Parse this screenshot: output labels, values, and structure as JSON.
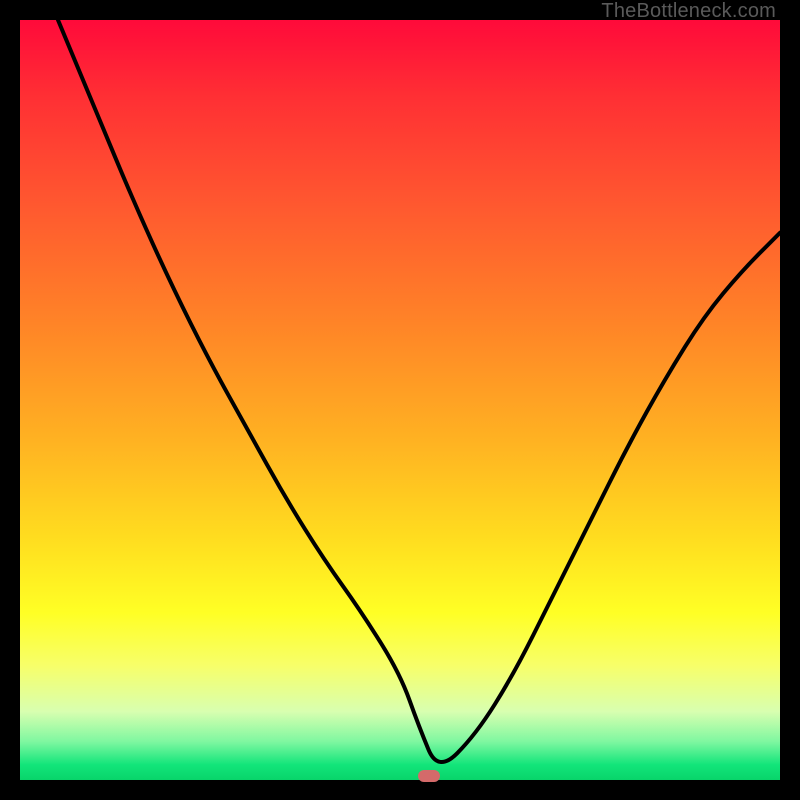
{
  "watermark": "TheBottleneck.com",
  "chart_data": {
    "type": "line",
    "title": "",
    "xlabel": "",
    "ylabel": "",
    "xlim": [
      0,
      100
    ],
    "ylim": [
      0,
      100
    ],
    "grid": false,
    "legend": false,
    "series": [
      {
        "name": "bottleneck-curve",
        "x": [
          5,
          10,
          15,
          20,
          25,
          30,
          35,
          40,
          45,
          50,
          52.5,
          55,
          60,
          65,
          70,
          75,
          80,
          85,
          90,
          95,
          100
        ],
        "y": [
          100,
          88,
          76,
          65,
          55,
          46,
          37,
          29,
          22,
          14,
          7,
          1,
          6,
          14,
          24,
          34,
          44,
          53,
          61,
          67,
          72
        ]
      }
    ],
    "marker": {
      "x": 53.8,
      "y": 0.5,
      "color": "#d46a6a"
    },
    "background_gradient": {
      "top": "#ff0a3a",
      "mid": "#ffe026",
      "bottom": "#08d46a"
    }
  }
}
